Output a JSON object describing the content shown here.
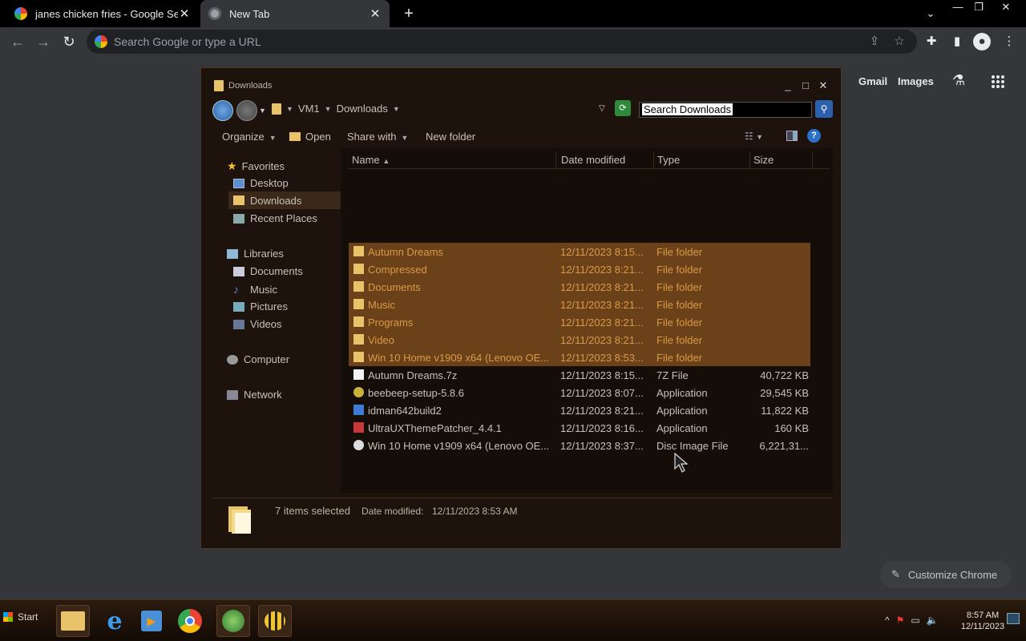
{
  "browser": {
    "tabs": [
      {
        "title": "janes chicken fries - Google Search"
      },
      {
        "title": "New Tab"
      }
    ],
    "omnibox_placeholder": "Search Google or type a URL",
    "ntp": {
      "gmail": "Gmail",
      "images": "Images",
      "customize": "Customize Chrome"
    }
  },
  "explorer": {
    "title": "Downloads",
    "breadcrumb": [
      "VM1",
      "Downloads"
    ],
    "search_text": "Search Downloads",
    "commands": {
      "organize": "Organize",
      "open": "Open",
      "share": "Share with",
      "new_folder": "New folder"
    },
    "nav": {
      "favorites": "Favorites",
      "fav_items": [
        "Desktop",
        "Downloads",
        "Recent Places"
      ],
      "libraries": "Libraries",
      "lib_items": [
        "Documents",
        "Music",
        "Pictures",
        "Videos"
      ],
      "computer": "Computer",
      "network": "Network"
    },
    "columns": {
      "name": "Name",
      "date": "Date modified",
      "type": "Type",
      "size": "Size"
    },
    "files": [
      {
        "name": "Autumn Dreams",
        "date": "12/11/2023 8:15...",
        "type": "File folder",
        "size": ""
      },
      {
        "name": "Compressed",
        "date": "12/11/2023 8:21...",
        "type": "File folder",
        "size": ""
      },
      {
        "name": "Documents",
        "date": "12/11/2023 8:21...",
        "type": "File folder",
        "size": ""
      },
      {
        "name": "Music",
        "date": "12/11/2023 8:21...",
        "type": "File folder",
        "size": ""
      },
      {
        "name": "Programs",
        "date": "12/11/2023 8:21...",
        "type": "File folder",
        "size": ""
      },
      {
        "name": "Video",
        "date": "12/11/2023 8:21...",
        "type": "File folder",
        "size": ""
      },
      {
        "name": "Win 10 Home v1909 x64 (Lenovo OE...",
        "date": "12/11/2023 8:53...",
        "type": "File folder",
        "size": ""
      },
      {
        "name": "Autumn Dreams.7z",
        "date": "12/11/2023 8:15...",
        "type": "7Z File",
        "size": "40,722 KB"
      },
      {
        "name": "beebeep-setup-5.8.6",
        "date": "12/11/2023 8:07...",
        "type": "Application",
        "size": "29,545 KB"
      },
      {
        "name": "idman642build2",
        "date": "12/11/2023 8:21...",
        "type": "Application",
        "size": "11,822 KB"
      },
      {
        "name": "UltraUXThemePatcher_4.4.1",
        "date": "12/11/2023 8:16...",
        "type": "Application",
        "size": "160 KB"
      },
      {
        "name": "Win 10 Home v1909 x64 (Lenovo OE...",
        "date": "12/11/2023 8:37...",
        "type": "Disc Image File",
        "size": "6,221,31..."
      }
    ],
    "details": {
      "count": "7 items selected",
      "date_label": "Date modified:",
      "date_value": "12/11/2023 8:53 AM"
    }
  },
  "taskbar": {
    "start": "Start",
    "time": "8:57 AM",
    "date": "12/11/2023"
  }
}
